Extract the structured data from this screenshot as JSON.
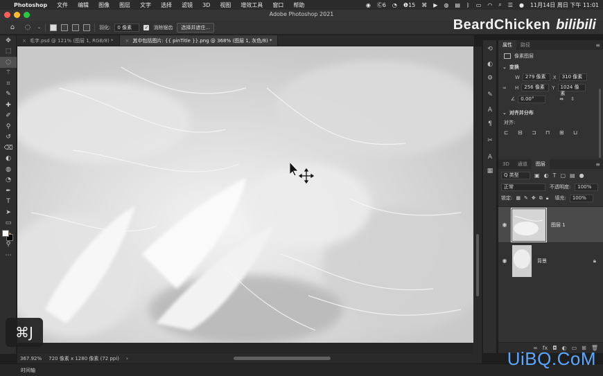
{
  "menubar": {
    "apple": "",
    "items": [
      "Photoshop",
      "文件",
      "编辑",
      "图像",
      "图层",
      "文字",
      "选择",
      "滤镜",
      "3D",
      "视图",
      "增效工具",
      "窗口",
      "帮助"
    ],
    "status": {
      "c_badge": "6",
      "badge_15": "15",
      "datetime": "11月14日 周日 下午 11:01"
    }
  },
  "window": {
    "title": "Adobe Photoshop 2021"
  },
  "options": {
    "feather_label": "羽化:",
    "feather_value": "0 像素",
    "antialias_label": "消除锯齿",
    "select_mask_button": "选择并遮住..."
  },
  "watermark": {
    "name": "BeardChicken",
    "logo": "bilibili"
  },
  "tabs": [
    {
      "label": "毛字.psd @ 121% (图层 1, RGB/8) *",
      "active": false
    },
    {
      "label": "其中包括图片: {{ pinTitle }}.png @ 368% (图层 1, 灰色/8) *",
      "active": true
    }
  ],
  "toolbar": {
    "tools": [
      {
        "name": "move-tool",
        "glyph": "✥"
      },
      {
        "name": "marquee-tool",
        "glyph": "⬚"
      },
      {
        "name": "lasso-tool",
        "glyph": "◌"
      },
      {
        "name": "magic-wand-tool",
        "glyph": "⚚"
      },
      {
        "name": "crop-tool",
        "glyph": "⌗"
      },
      {
        "name": "eyedropper-tool",
        "glyph": "✎"
      },
      {
        "name": "healing-brush-tool",
        "glyph": "✚"
      },
      {
        "name": "brush-tool",
        "glyph": "✐"
      },
      {
        "name": "clone-stamp-tool",
        "glyph": "⚲"
      },
      {
        "name": "history-brush-tool",
        "glyph": "↺"
      },
      {
        "name": "eraser-tool",
        "glyph": "⌫"
      },
      {
        "name": "gradient-tool",
        "glyph": "◐"
      },
      {
        "name": "blur-tool",
        "glyph": "◍"
      },
      {
        "name": "dodge-tool",
        "glyph": "◔"
      },
      {
        "name": "pen-tool",
        "glyph": "✒"
      },
      {
        "name": "type-tool",
        "glyph": "T"
      },
      {
        "name": "path-selection-tool",
        "glyph": "➤"
      },
      {
        "name": "shape-tool",
        "glyph": "▭"
      },
      {
        "name": "hand-tool",
        "glyph": "✋"
      },
      {
        "name": "zoom-tool",
        "glyph": "⚲"
      },
      {
        "name": "more-tools",
        "glyph": "⋯"
      }
    ],
    "foreground": "#ffffff",
    "background": "#000000"
  },
  "status": {
    "zoom": "367.92%",
    "doc_info": "720 像素 x 1280 像素 (72 ppi)",
    "arrow": "›"
  },
  "timeline_label": "时间轴",
  "shortcut_overlay": "⌘J",
  "properties": {
    "tabs": [
      "属性",
      "路径"
    ],
    "kind": "像素图层",
    "transform_title": "变换",
    "w_label": "W",
    "w_value": "279 像素",
    "x_label": "X",
    "x_value": "310 像素",
    "h_label": "H",
    "h_value": "256 像素",
    "y_label": "Y",
    "y_value": "1024 像素",
    "angle_value": "0.00°",
    "align_title": "对齐并分布",
    "align_label": "对齐:"
  },
  "layers": {
    "tabs": [
      "3D",
      "通道",
      "图层"
    ],
    "filter_label": "Q 类型",
    "blend_mode": "正常",
    "opacity_label": "不透明度:",
    "opacity_value": "100%",
    "lock_label": "锁定:",
    "fill_label": "填充:",
    "fill_value": "100%",
    "items": [
      {
        "name": "图层 1",
        "selected": true,
        "locked": false
      },
      {
        "name": "背景",
        "selected": false,
        "locked": true
      }
    ]
  },
  "brand": "UiBQ.CoM",
  "colors": {
    "red_light": "#ff5f57",
    "yellow_light": "#febc2e",
    "green_light": "#28c840",
    "brand_blue": "#5aa7ff"
  }
}
